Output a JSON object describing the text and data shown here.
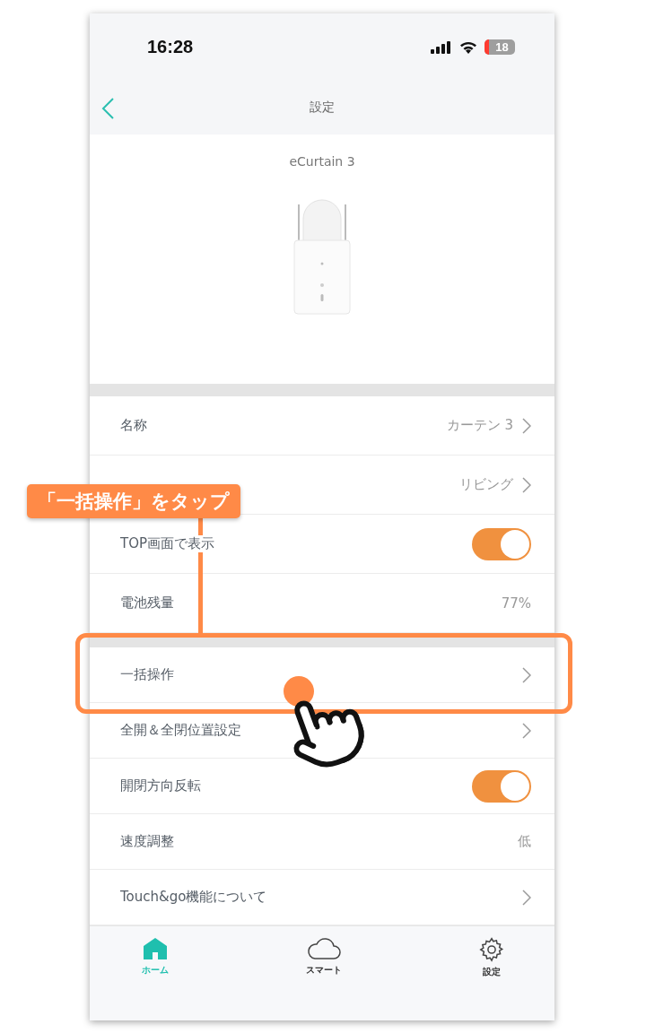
{
  "status_bar": {
    "time": "16:28",
    "battery": "18"
  },
  "header": {
    "title": "設定"
  },
  "device": {
    "name": "eCurtain 3"
  },
  "groups": [
    {
      "rows": [
        {
          "kind": "link",
          "label": "名称",
          "value": "カーテン 3"
        },
        {
          "kind": "link",
          "value": "リビング"
        },
        {
          "kind": "toggle",
          "label": "TOP画面で表示",
          "on": true
        },
        {
          "kind": "value",
          "label": "電池残量",
          "value": "77%"
        }
      ]
    },
    {
      "rows": [
        {
          "kind": "link",
          "label": "一括操作"
        },
        {
          "kind": "link",
          "label": "全開＆全閉位置設定"
        },
        {
          "kind": "toggle",
          "label": "開閉方向反転",
          "on": true
        },
        {
          "kind": "value",
          "label": "速度調整",
          "value": "低"
        },
        {
          "kind": "link",
          "label": "Touch&go機能について"
        }
      ]
    }
  ],
  "tab_bar": [
    {
      "label": "ホーム",
      "selected": true
    },
    {
      "label": "スマート",
      "selected": false
    },
    {
      "label": "設定",
      "selected": false
    }
  ],
  "annotation": {
    "label": "「一括操作」をタップ"
  }
}
